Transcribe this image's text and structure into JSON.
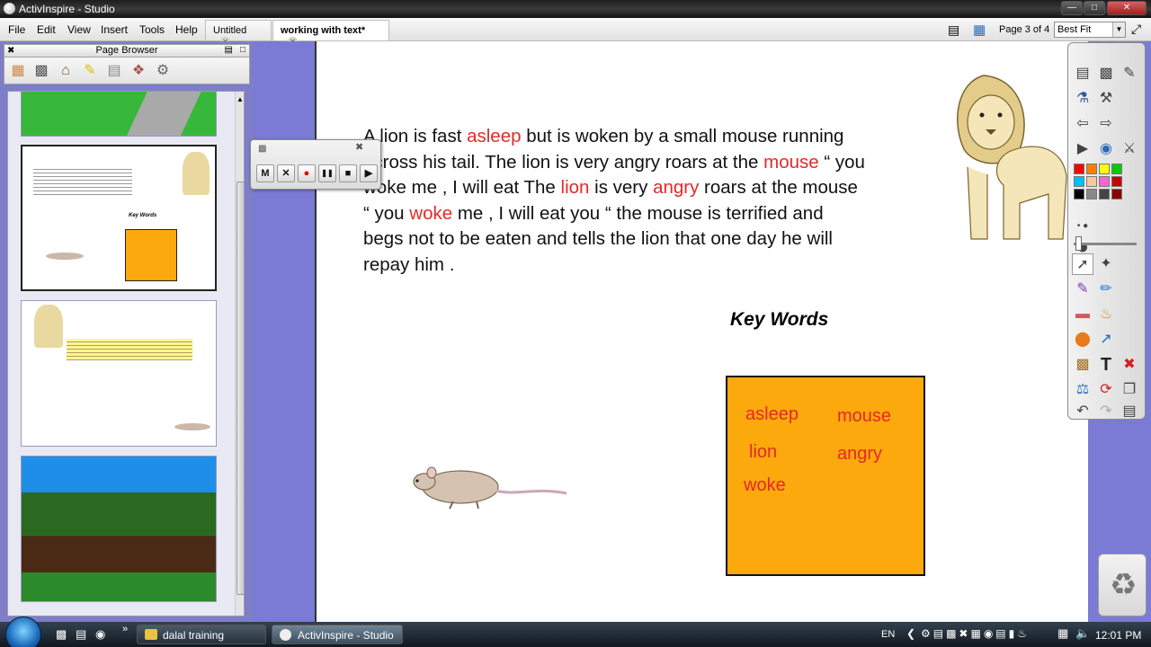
{
  "window": {
    "title": "ActivInspire - Studio"
  },
  "menu": {
    "items": [
      "File",
      "Edit",
      "View",
      "Insert",
      "Tools",
      "Help"
    ]
  },
  "tabs": [
    {
      "label": "Untitled",
      "active": false
    },
    {
      "label": "working with text*",
      "active": true
    }
  ],
  "nav": {
    "page_label": "Page 3 of 4",
    "zoom": "Best Fit"
  },
  "page_browser": {
    "title": "Page Browser",
    "thumb2_keywords_title": "Key Words"
  },
  "story": {
    "parts": [
      {
        "text": "A lion is fast ",
        "hl": false
      },
      {
        "text": "asleep",
        "hl": true
      },
      {
        "text": " but is woken by a small mouse running across his tail. The lion is very angry roars at the ",
        "hl": false
      },
      {
        "text": "mouse",
        "hl": true
      },
      {
        "text": " “ you woke me , I will eat The ",
        "hl": false
      },
      {
        "text": "lion",
        "hl": true
      },
      {
        "text": " is very ",
        "hl": false
      },
      {
        "text": "angry",
        "hl": true
      },
      {
        "text": " roars at the mouse “ you ",
        "hl": false
      },
      {
        "text": "woke",
        "hl": true
      },
      {
        "text": " me , I will eat you “ the mouse is terrified and begs not to be eaten and tells the lion that one day he will repay him .",
        "hl": false
      }
    ],
    "highlight_color": "#e5282a"
  },
  "key_words": {
    "title": "Key Words",
    "box_color": "#fba90c",
    "words": [
      "asleep",
      "mouse",
      "lion",
      "angry",
      "woke"
    ]
  },
  "recorder": {
    "buttons": [
      "M",
      "✕",
      "●",
      "❚❚",
      "■",
      "▶"
    ]
  },
  "taskbar": {
    "items": [
      {
        "label": "dalal training",
        "active": false
      },
      {
        "label": "ActivInspire - Studio",
        "active": true
      }
    ],
    "language": "EN",
    "clock": "12:01 PM"
  },
  "palette": [
    "#ff0000",
    "#ff8000",
    "#ffff00",
    "#00cc00",
    "#00bfff",
    "#f5c8a0",
    "#ff66cc",
    "#cc0000",
    "#000000",
    "#888888",
    "#444444",
    "#8b0000"
  ]
}
